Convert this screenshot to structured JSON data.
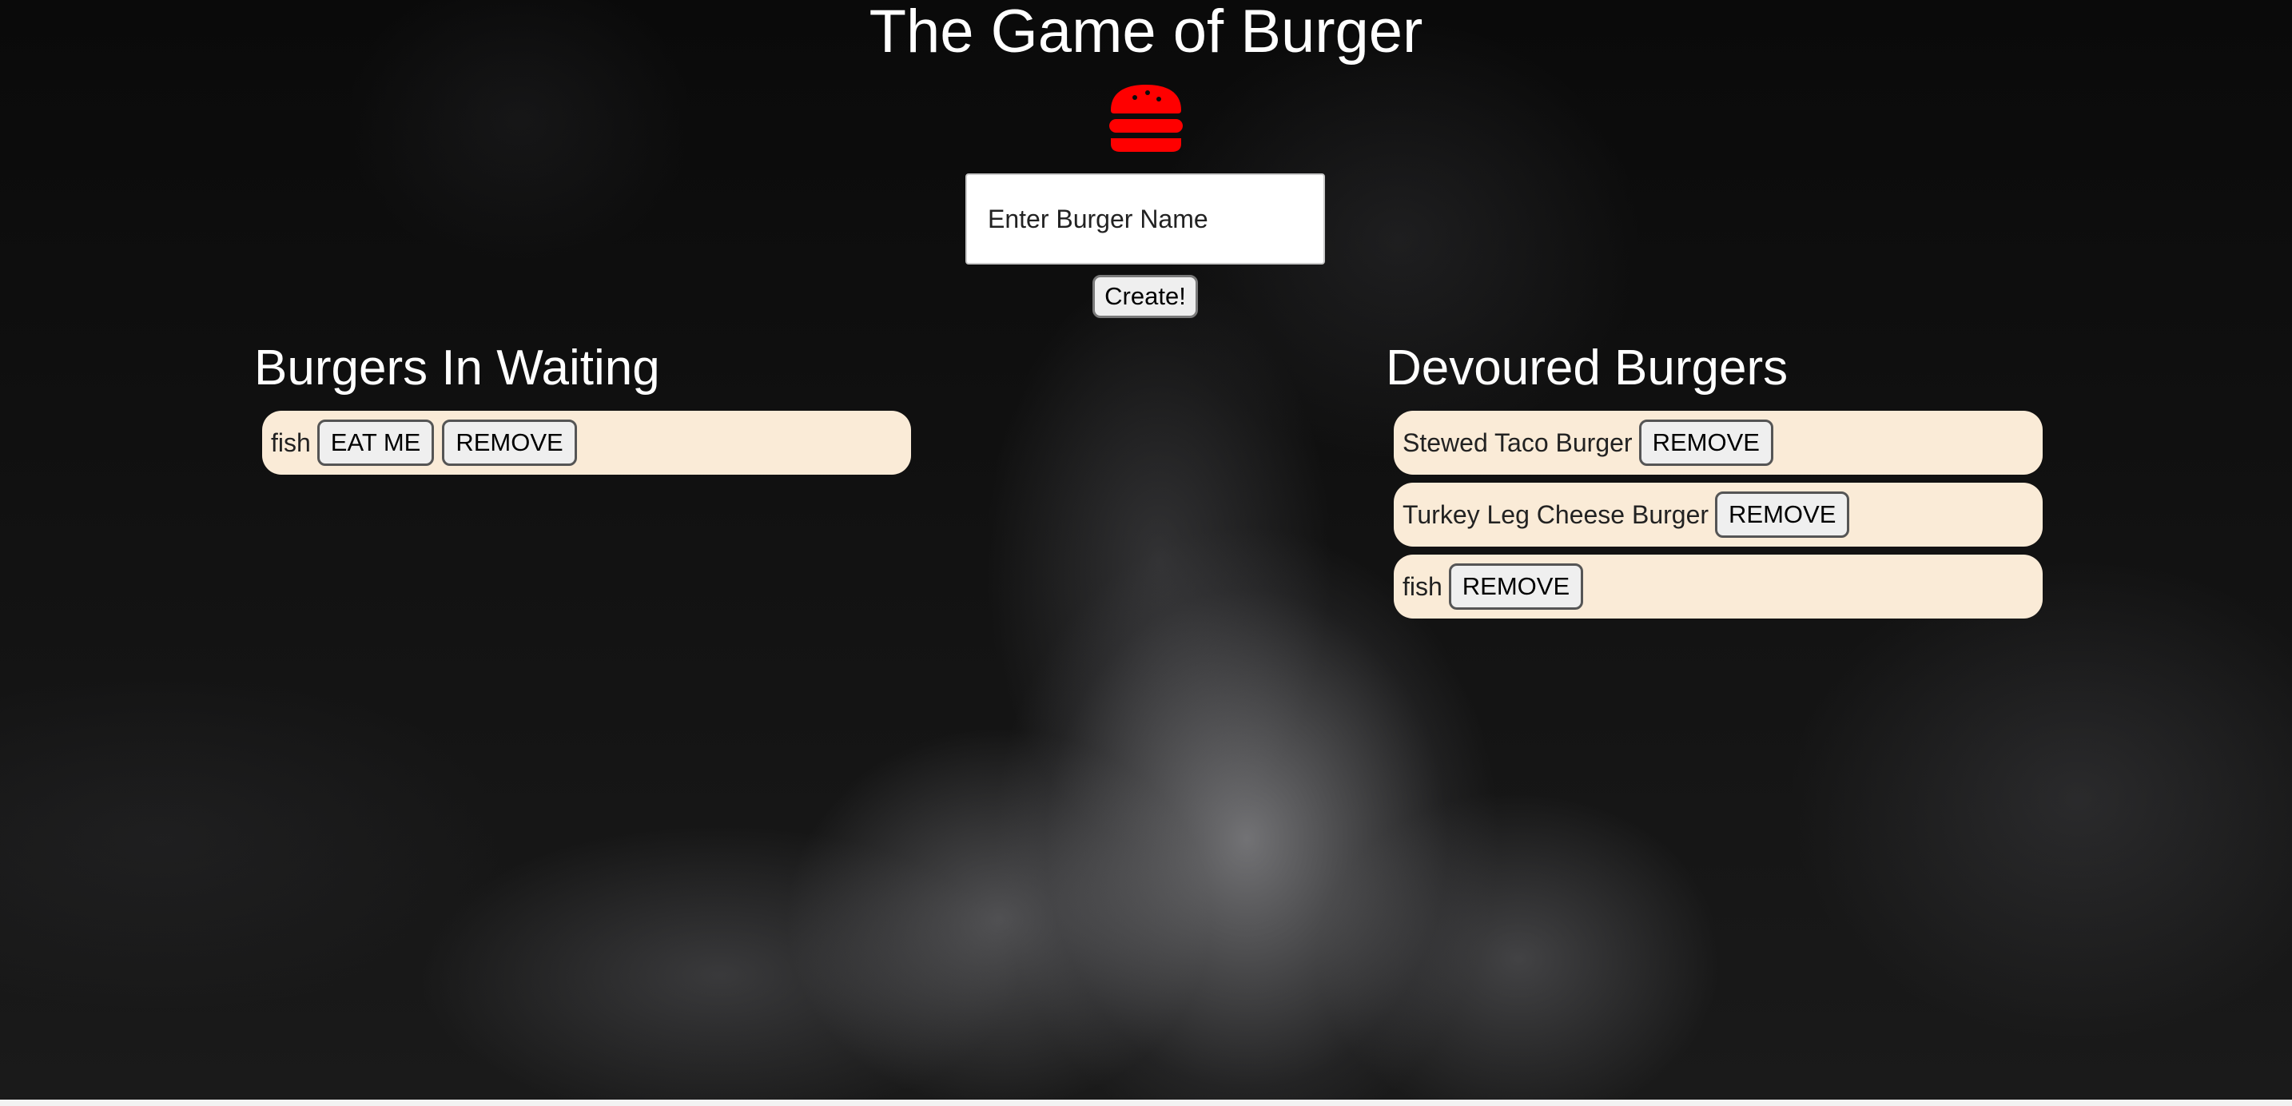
{
  "page": {
    "title": "The Game of Burger",
    "logo_icon": "burger-icon",
    "accent_color": "#ff0000",
    "row_background": "#faebd7"
  },
  "create_form": {
    "placeholder": "Enter Burger Name",
    "value": "",
    "submit_label": "Create!"
  },
  "waiting": {
    "heading": "Burgers In Waiting",
    "items": [
      {
        "name": "fish",
        "eat_label": "EAT ME",
        "remove_label": "REMOVE"
      }
    ]
  },
  "devoured": {
    "heading": "Devoured Burgers",
    "items": [
      {
        "name": "Stewed Taco Burger",
        "remove_label": "REMOVE"
      },
      {
        "name": "Turkey Leg Cheese Burger",
        "remove_label": "REMOVE"
      },
      {
        "name": "fish",
        "remove_label": "REMOVE"
      }
    ]
  }
}
